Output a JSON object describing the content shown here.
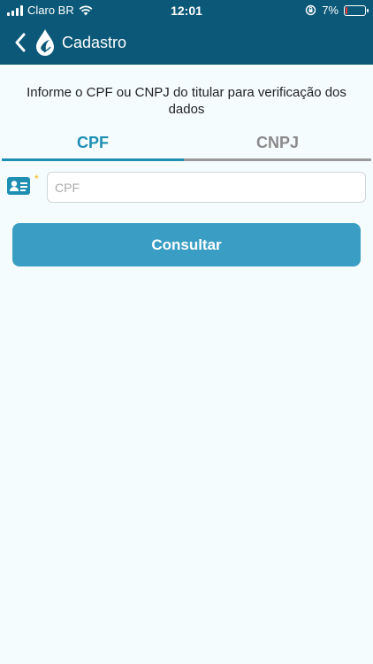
{
  "status_bar": {
    "carrier": "Claro BR",
    "time": "12:01",
    "battery_percent": "7%",
    "battery_level": 0.07
  },
  "nav": {
    "title": "Cadastro",
    "back_icon": "chevron-left-icon",
    "logo_icon": "water-drop-logo-icon"
  },
  "form": {
    "instructions": "Informe o CPF ou CNPJ do titular para verificação dos dados",
    "tabs": [
      {
        "label": "CPF",
        "active": true
      },
      {
        "label": "CNPJ",
        "active": false
      }
    ],
    "required_mark": "*",
    "cpf_field": {
      "value": "",
      "placeholder": "CPF",
      "icon": "id-card-icon"
    },
    "submit_label": "Consultar"
  },
  "colors": {
    "header_bg": "#0b5878",
    "accent": "#1e8fb3",
    "button": "#3a9ec4",
    "required": "#f2b200",
    "page_bg": "#f5fcfd"
  }
}
